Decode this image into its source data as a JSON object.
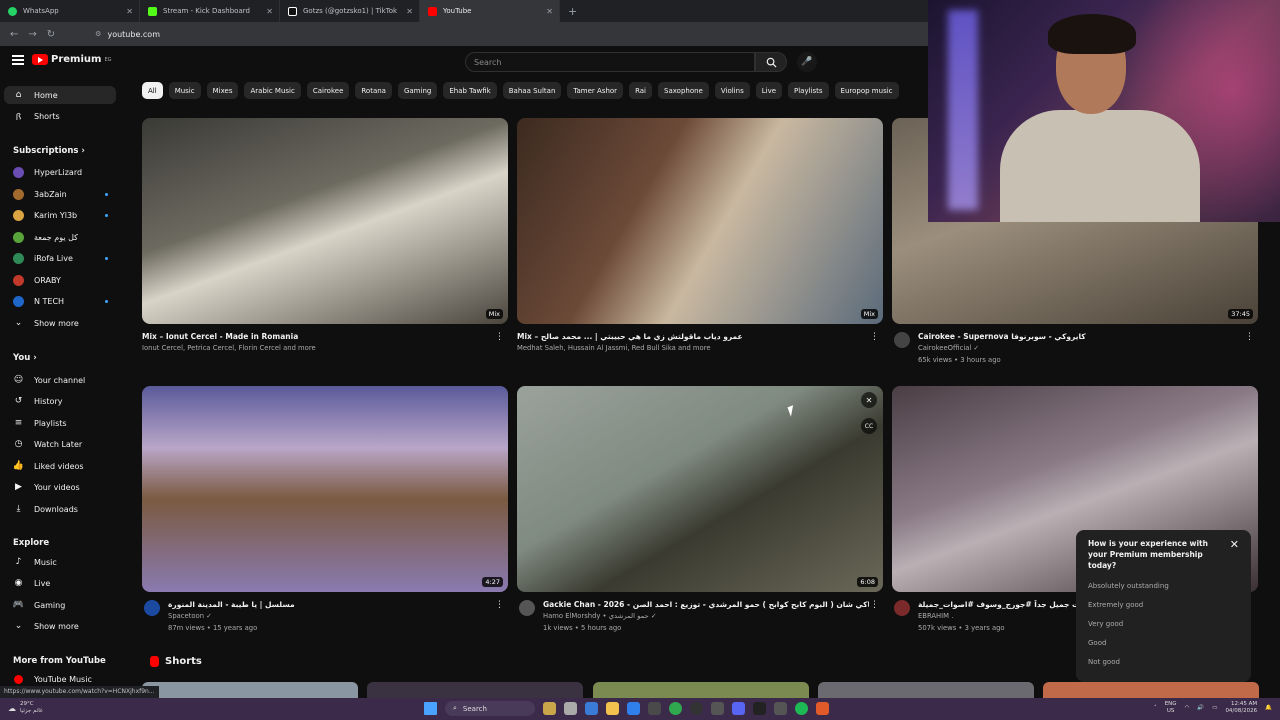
{
  "browser": {
    "tabs": [
      {
        "label": "WhatsApp",
        "color": "#25d366"
      },
      {
        "label": "Stream - Kick Dashboard",
        "color": "#53fc18"
      },
      {
        "label": "Gotzs (@gotzsko1) | TikTok",
        "color": "#ffffff"
      },
      {
        "label": "YouTube",
        "color": "#ff0000"
      }
    ],
    "new_tab": "+",
    "url": "youtube.com",
    "status_url": "https://www.youtube.com/watch?v=HCNXjhxf9n..."
  },
  "youtube": {
    "logo_text": "Premium",
    "logo_sup": "EG",
    "search_placeholder": "Search",
    "sidebar": {
      "main": [
        {
          "label": "Home",
          "icon": "home-icon"
        },
        {
          "label": "Shorts",
          "icon": "shorts-icon"
        }
      ],
      "subscriptions_heading": "Subscriptions ›",
      "subscriptions": [
        {
          "label": "HyperLizard",
          "color": "#6a4cb3"
        },
        {
          "label": "3abZain",
          "color": "#a36a2e"
        },
        {
          "label": "Karim Yl3b",
          "color": "#d9a441"
        },
        {
          "label": "كل يوم جمعة",
          "color": "#58a33a"
        },
        {
          "label": "iRofa Live",
          "color": "#2e8b57"
        },
        {
          "label": "ORABY",
          "color": "#c0392b"
        },
        {
          "label": "N TECH",
          "color": "#1e66c8"
        },
        {
          "label": "Show more",
          "color": ""
        }
      ],
      "you_heading": "You ›",
      "you": [
        {
          "label": "Your channel",
          "icon": "channel-icon"
        },
        {
          "label": "History",
          "icon": "history-icon"
        },
        {
          "label": "Playlists",
          "icon": "playlists-icon"
        },
        {
          "label": "Watch Later",
          "icon": "watch-later-icon"
        },
        {
          "label": "Liked videos",
          "icon": "like-icon"
        },
        {
          "label": "Your videos",
          "icon": "your-videos-icon"
        },
        {
          "label": "Downloads",
          "icon": "download-icon"
        }
      ],
      "explore_heading": "Explore",
      "explore": [
        {
          "label": "Music",
          "icon": "music-icon"
        },
        {
          "label": "Live",
          "icon": "live-icon"
        },
        {
          "label": "Gaming",
          "icon": "gaming-icon"
        },
        {
          "label": "Show more",
          "icon": "chevron-down-icon"
        }
      ],
      "more_heading": "More from YouTube",
      "more": [
        {
          "label": "YouTube Music",
          "icon": "youtube-music-icon"
        }
      ]
    },
    "chips": [
      "All",
      "Music",
      "Mixes",
      "Arabic Music",
      "Cairokee",
      "Rotana",
      "Gaming",
      "Ehab Tawfik",
      "Bahaa Sultan",
      "Tamer Ashor",
      "Rai",
      "Saxophone",
      "Violins",
      "Live",
      "Playlists",
      "Europop music"
    ],
    "videos": [
      {
        "title": "Mix – Ionut Cercel - Made in Romania",
        "sub": "Ionut Cercel, Petrica Cercel, Florin Cercel and more",
        "sub2": "",
        "badge": "Mix",
        "thumb": "linear-gradient(160deg,#3a3a36 0%,#6d6a60 40%,#d8d4c8 55%,#4a463e 100%)",
        "avatar": ""
      },
      {
        "title": "Mix – عمرو دياب ماقولتش زي ما هي حبيبتي | ... محمد صالح",
        "sub": "Medhat Saleh, Hussain Al Jassmi, Red Bull Sika and more",
        "sub2": "",
        "badge": "Mix",
        "thumb": "linear-gradient(120deg,#3c2a20 0%,#6c4a38 35%,#c9b8a0 55%,#5a6a7a 100%)",
        "avatar": ""
      },
      {
        "title": "Cairokee - Supernova كايروكي - سوبرنوفا",
        "sub": "CairokeeOfficial ✓",
        "sub2": "65k views • 3 hours ago",
        "badge": "37:45",
        "thumb": "linear-gradient(160deg,#6b6256 0%,#9b8e7c 40%,#4a4238 100%)",
        "avatar": "#444"
      },
      {
        "title": "مسلسل | يا طيبة - المدينة المنورة",
        "sub": "Spacetoon ✓",
        "sub2": "87m views • 15 years ago",
        "badge": "4:27",
        "thumb": "linear-gradient(180deg,#5a5a9a 0%,#b9a6c8 30%,#7a5a40 55%,#8a7ab0 100%)",
        "avatar": "#1c4aa0"
      },
      {
        "title": "Gackie Chan - 2026 - جاكي شان ( البوم كابح كوابح ) حمو المرشدي - توزيع : احمد الصن",
        "sub": "Hamo ElMorshdy • حمو المرشدي ✓",
        "sub2": "1k views • 5 hours ago",
        "badge": "6:08",
        "thumb": "linear-gradient(150deg,#9aa29c 0%,#7f8a80 40%,#3a3a30 60%,#6a6858 100%)",
        "avatar": "#555"
      },
      {
        "title": "جورج وسوف - اغنية بصوت جميل جداً #جورج_وسوف #اصوات_جميلة",
        "sub": "EBRAHIM .",
        "sub2": "507k views • 3 years ago",
        "badge": "",
        "thumb": "linear-gradient(160deg,#4a3e44 0%,#8a7a86 40%,#bab0b4 55%,#3a3034 100%)",
        "avatar": "#7a2a2a"
      }
    ],
    "shorts_heading": "Shorts",
    "survey": {
      "question": "How is your experience with your Premium membership today?",
      "options": [
        "Absolutely outstanding",
        "Extremely good",
        "Very good",
        "Good",
        "Not good"
      ]
    }
  },
  "taskbar": {
    "weather_temp": "29°C",
    "weather_text": "غائم جزئيا",
    "search_label": "Search",
    "lang": "ENG",
    "region": "US",
    "time": "12:45 AM",
    "date": "04/08/2026"
  }
}
